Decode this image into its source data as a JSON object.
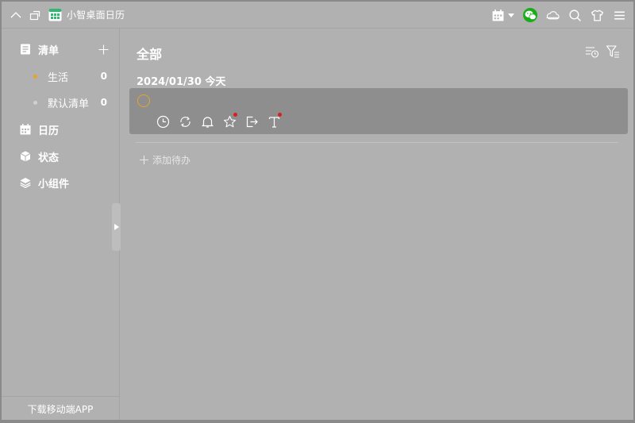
{
  "app": {
    "title": "小智桌面日历"
  },
  "sidebar": {
    "lists_label": "清单",
    "lists": [
      {
        "label": "生活",
        "count": "0",
        "dot_color": "#e5a52c"
      },
      {
        "label": "默认清单",
        "count": "0",
        "dot_color": "#d0d0d0"
      }
    ],
    "calendar_label": "日历",
    "status_label": "状态",
    "widget_label": "小组件",
    "download_label": "下载移动端APP"
  },
  "main": {
    "title": "全部",
    "date_header": "2024/01/30 今天",
    "add_todo_label": "添加待办"
  },
  "icons": {
    "titlebar_left": [
      "chevron-up-icon",
      "pin-icon"
    ],
    "titlebar_right": [
      "calendar-icon",
      "wechat-icon",
      "cloud-icon",
      "search-icon",
      "shirt-icon",
      "menu-icon"
    ],
    "task_tools": [
      "clock-icon",
      "repeat-icon",
      "bell-icon",
      "star-icon",
      "export-icon",
      "text-icon"
    ]
  },
  "colors": {
    "background": "#b1b1b1",
    "task_card": "#8e8e8e",
    "check_ring": "#e5a52c",
    "wechat_green": "#1aad19",
    "badge_red": "#d52020"
  }
}
